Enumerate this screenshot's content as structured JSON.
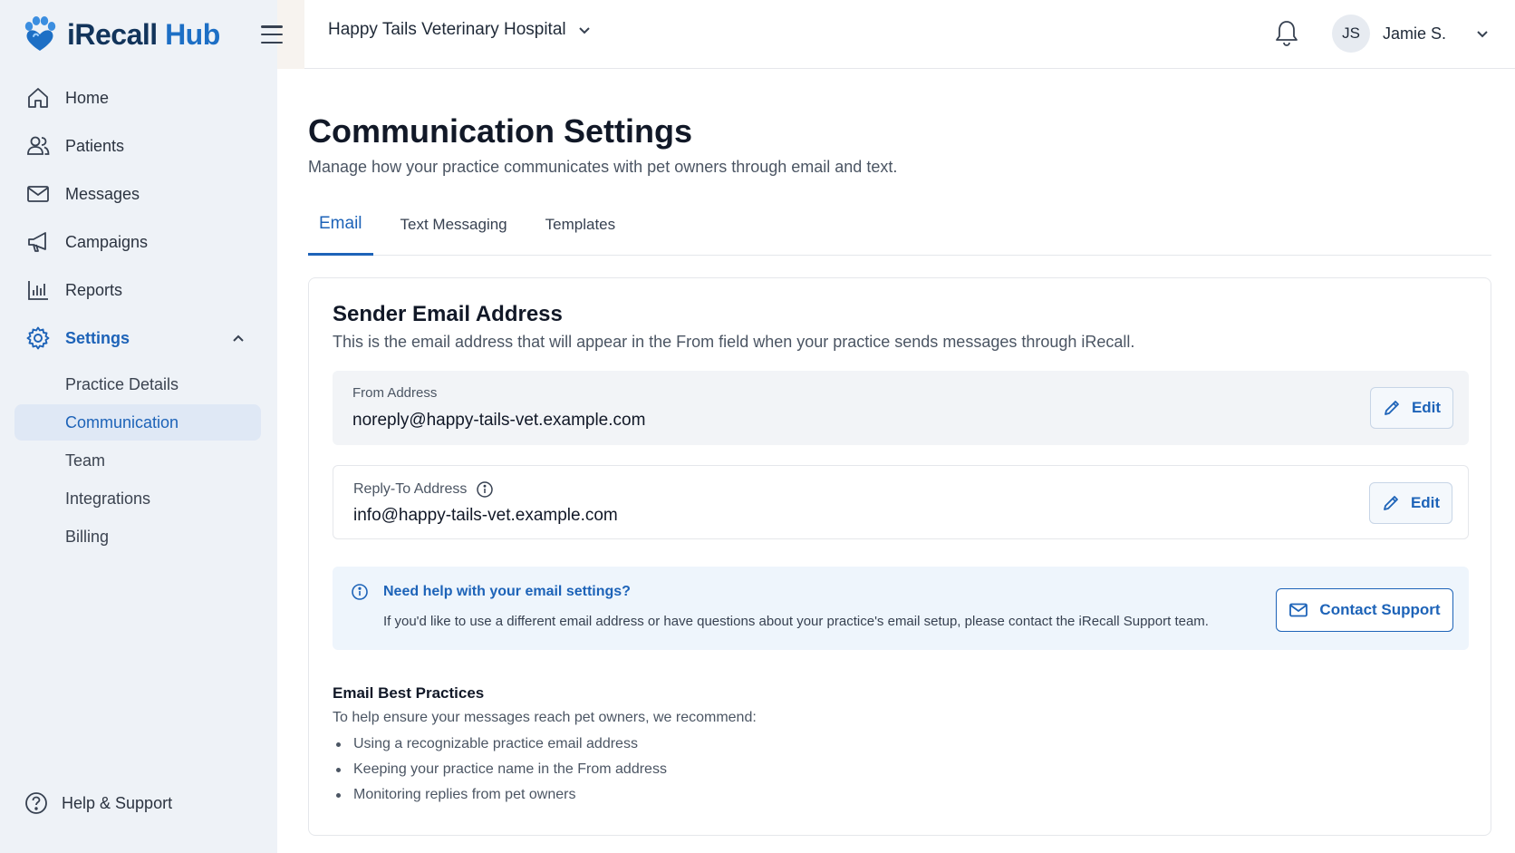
{
  "brand": {
    "name_part1": "iRecall",
    "name_part2": "Hub",
    "logo_icon": "paw-heart-icon"
  },
  "colors": {
    "accent": "#1d63b8",
    "brand_dark": "#12345b",
    "sidebar_bg": "#eef2f7",
    "active_bg": "#dfe8f5",
    "info_bg": "#eef5fc"
  },
  "sidebar": {
    "items": [
      {
        "label": "Home",
        "icon": "home-icon"
      },
      {
        "label": "Patients",
        "icon": "users-icon"
      },
      {
        "label": "Messages",
        "icon": "mail-icon"
      },
      {
        "label": "Campaigns",
        "icon": "megaphone-icon"
      },
      {
        "label": "Reports",
        "icon": "bar-chart-icon"
      },
      {
        "label": "Settings",
        "icon": "gear-icon",
        "expanded": true
      }
    ],
    "settings_sub": [
      {
        "label": "Practice Details"
      },
      {
        "label": "Communication",
        "active": true
      },
      {
        "label": "Team"
      },
      {
        "label": "Integrations"
      },
      {
        "label": "Billing"
      }
    ],
    "help_label": "Help & Support"
  },
  "header": {
    "practice_name": "Happy Tails Veterinary Hospital",
    "user_initials": "JS",
    "user_name": "Jamie S."
  },
  "page": {
    "title": "Communication Settings",
    "subtitle": "Manage how your practice communicates with pet owners through email and text.",
    "tabs": [
      {
        "label": "Email",
        "active": true
      },
      {
        "label": "Text Messaging"
      },
      {
        "label": "Templates"
      }
    ]
  },
  "sender": {
    "title": "Sender Email Address",
    "description": "This is the email address that will appear in the From field when your practice sends messages through iRecall.",
    "from_label": "From Address",
    "from_value": "noreply@happy-tails-vet.example.com",
    "reply_label": "Reply-To Address",
    "reply_value": "info@happy-tails-vet.example.com",
    "edit_label": "Edit"
  },
  "help_box": {
    "heading": "Need help with your email settings?",
    "text": "If you'd like to use a different email address or have questions about your practice's email setup, please contact the iRecall Support team.",
    "button_label": "Contact Support"
  },
  "best_practices": {
    "title": "Email Best Practices",
    "intro": "To help ensure your messages reach pet owners, we recommend:",
    "items": [
      "Using a recognizable practice email address",
      "Keeping your practice name in the From address",
      "Monitoring replies from pet owners"
    ]
  }
}
